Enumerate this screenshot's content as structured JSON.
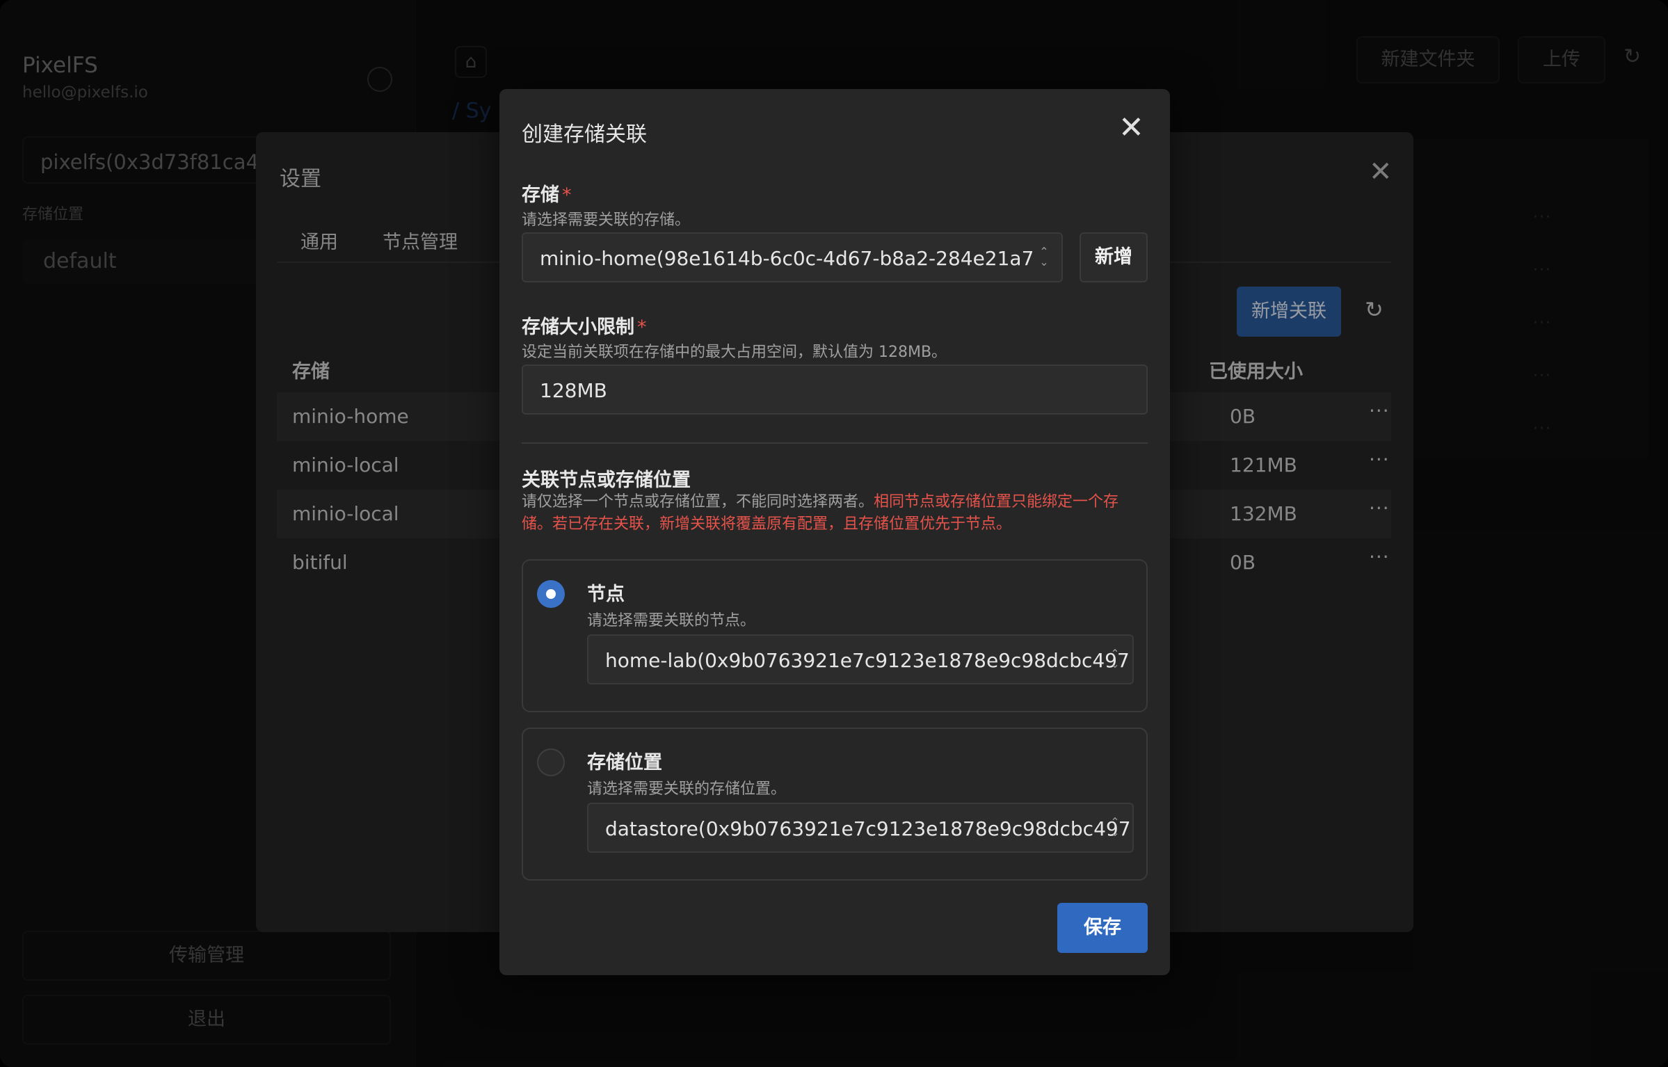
{
  "sidebar": {
    "app_name": "PixelFS",
    "email": "hello@pixelfs.io",
    "node": "pixelfs(0x3d73f81ca431",
    "location_label": "存储位置",
    "location_value": "default",
    "transfer_button": "传输管理",
    "logout_button": "退出"
  },
  "main": {
    "new_folder_button": "新建文件夹",
    "upload_button": "上传",
    "breadcrumb": "/  Sy",
    "row_more": "···"
  },
  "settings": {
    "title": "设置",
    "tabs": [
      "通用",
      "节点管理"
    ],
    "new_association_button": "新增关联",
    "columns": {
      "storage": "存储",
      "used_size": "已使用大小"
    },
    "rows": [
      {
        "name": "minio-home",
        "used": "0B",
        "more": "···"
      },
      {
        "name": "minio-local",
        "used": "121MB",
        "more": "···"
      },
      {
        "name": "minio-local",
        "used": "132MB",
        "more": "···"
      },
      {
        "name": "bitiful",
        "used": "0B",
        "more": "···"
      }
    ]
  },
  "dialog": {
    "title": "创建存储关联",
    "close_glyph": "✕",
    "storage_label": "存储",
    "required_mark": "*",
    "storage_hint": "请选择需要关联的存储。",
    "storage_value": "minio-home(98e1614b-6c0c-4d67-b8a2-284e21a7",
    "add_button": "新增",
    "size_label": "存储大小限制",
    "size_hint": "设定当前关联项在存储中的最大占用空间，默认值为 128MB。",
    "size_value": "128MB",
    "assoc_label": "关联节点或存储位置",
    "assoc_hint_normal": "请仅选择一个节点或存储位置，不能同时选择两者。",
    "assoc_hint_warning": "相同节点或存储位置只能绑定一个存储。若已存在关联，新增关联将覆盖原有配置，且存储位置优先于节点。",
    "node_option": {
      "title": "节点",
      "hint": "请选择需要关联的节点。",
      "value": "home-lab(0x9b0763921e7c9123e1878e9c98dcbc497",
      "selected": true
    },
    "location_option": {
      "title": "存储位置",
      "hint": "请选择需要关联的存储位置。",
      "value": "datastore(0x9b0763921e7c9123e1878e9c98dcbc497",
      "selected": false
    },
    "save_button": "保存"
  },
  "colors": {
    "accent": "#2f6ac0",
    "warning": "#e5534b",
    "dialog_bg": "#262626"
  }
}
